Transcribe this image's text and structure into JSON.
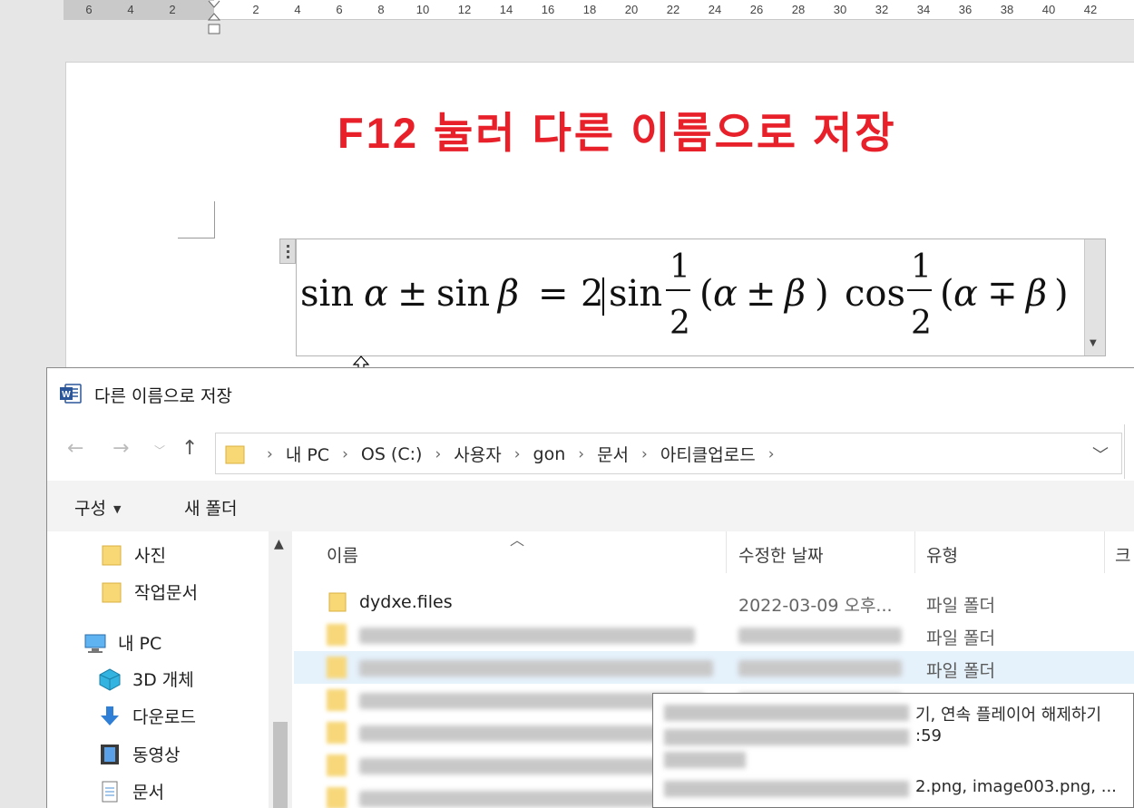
{
  "ruler": {
    "left_numbers": [
      "6",
      "4",
      "2"
    ],
    "right_numbers": [
      "2",
      "4",
      "6",
      "8",
      "10",
      "12",
      "14",
      "16",
      "18",
      "20",
      "22",
      "24",
      "26",
      "28",
      "30",
      "32",
      "34",
      "36",
      "38",
      "40",
      "42"
    ]
  },
  "document": {
    "banner": "F12 눌러 다른 이름으로 저장",
    "banner_color": "#e8202a",
    "equation": "sin α ± sin β = 2 sin ½(α ± β) cos ½(α ∓ β)"
  },
  "dialog": {
    "title": "다른 이름으로 저장",
    "app_icon": "word-icon",
    "breadcrumbs": [
      "내 PC",
      "OS (C:)",
      "사용자",
      "gon",
      "문서",
      "아티클업로드"
    ],
    "toolbar": {
      "organize_label": "구성",
      "new_folder_label": "새 폴더"
    },
    "nav_items": [
      {
        "label": "사진",
        "icon": "folder-icon"
      },
      {
        "label": "작업문서",
        "icon": "folder-icon"
      },
      {
        "label": "내 PC",
        "icon": "computer-icon"
      },
      {
        "label": "3D 개체",
        "icon": "3d-objects-icon"
      },
      {
        "label": "다운로드",
        "icon": "download-icon"
      },
      {
        "label": "동영상",
        "icon": "video-icon"
      },
      {
        "label": "문서",
        "icon": "document-icon"
      }
    ],
    "columns": {
      "name": "이름",
      "date": "수정한 날짜",
      "type": "유형",
      "size": "크"
    },
    "files": [
      {
        "name": "dydxe.files",
        "date": "2022-03-09 오후...",
        "type": "파일 폴더"
      },
      {
        "name": "",
        "date": "",
        "type": "파일 폴더"
      },
      {
        "name": "",
        "date": "",
        "type": "파일 폴더"
      },
      {
        "name": "",
        "date": "",
        "type": ""
      },
      {
        "name": "",
        "date": "",
        "type": ""
      },
      {
        "name": "",
        "date": "",
        "type": ""
      },
      {
        "name": "",
        "date": "",
        "type": ""
      }
    ],
    "tooltip": {
      "line1": "기, 연속 플레이어 해제하기",
      "line2": ":59",
      "line3": "2.png, image003.png, ..."
    }
  }
}
